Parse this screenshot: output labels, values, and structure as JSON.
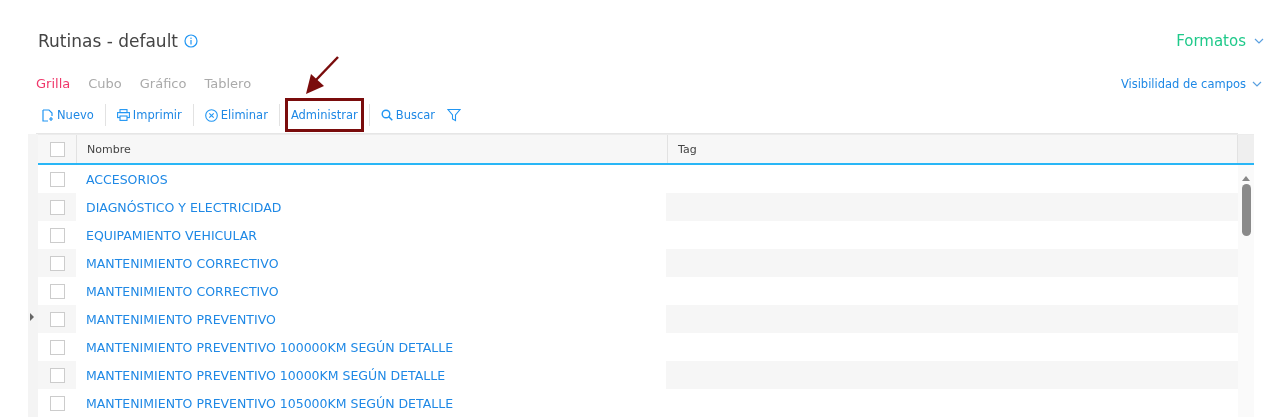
{
  "page": {
    "title": "Rutinas - default",
    "formats_label": "Formatos",
    "field_visibility_label": "Visibilidad de campos"
  },
  "tabs": [
    {
      "label": "Grilla",
      "selected": true
    },
    {
      "label": "Cubo",
      "selected": false
    },
    {
      "label": "Gráfico",
      "selected": false
    },
    {
      "label": "Tablero",
      "selected": false
    }
  ],
  "toolbar": [
    {
      "kind": "new",
      "label": "Nuevo"
    },
    {
      "kind": "print",
      "label": "Imprimir"
    },
    {
      "kind": "delete",
      "label": "Eliminar"
    },
    {
      "kind": "plain",
      "label": "Administrar",
      "highlighted": true
    },
    {
      "kind": "search",
      "label": "Buscar"
    },
    {
      "kind": "filter"
    }
  ],
  "table": {
    "columns": [
      "Nombre",
      "Tag"
    ],
    "select_all_checked": false,
    "rows": [
      {
        "nombre": "ACCESORIOS",
        "checked": false
      },
      {
        "nombre": "DIAGNÓSTICO Y ELECTRICIDAD",
        "checked": false
      },
      {
        "nombre": "EQUIPAMIENTO VEHICULAR",
        "checked": false
      },
      {
        "nombre": "MANTENIMIENTO CORRECTIVO",
        "checked": false
      },
      {
        "nombre": "MANTENIMIENTO CORRECTIVO",
        "checked": false
      },
      {
        "nombre": "MANTENIMIENTO PREVENTIVO",
        "checked": false
      },
      {
        "nombre": "MANTENIMIENTO PREVENTIVO 100000KM SEGÚN DETALLE",
        "checked": false
      },
      {
        "nombre": "MANTENIMIENTO PREVENTIVO 10000KM SEGÚN DETALLE",
        "checked": false
      },
      {
        "nombre": "MANTENIMIENTO PREVENTIVO 105000KM SEGÚN DETALLE",
        "checked": false
      }
    ]
  }
}
